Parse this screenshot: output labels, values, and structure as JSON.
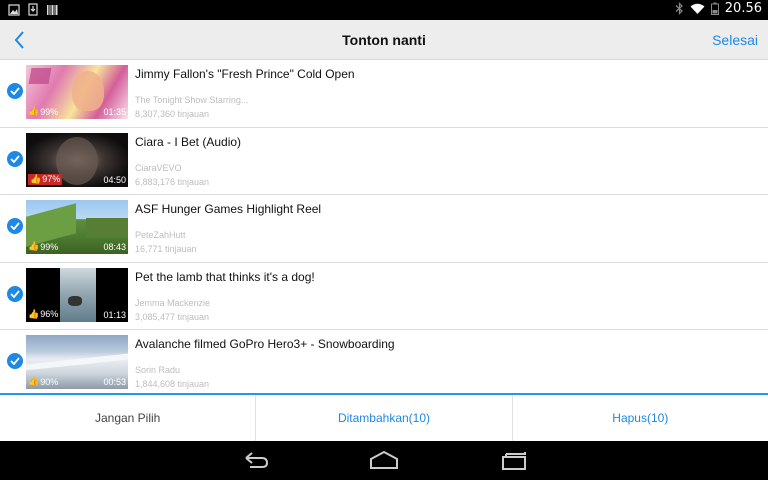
{
  "status_bar": {
    "time": "20.56",
    "icons": [
      "image-icon",
      "download-icon",
      "barcode-icon",
      "bluetooth-icon",
      "wifi-icon",
      "battery-icon"
    ]
  },
  "header": {
    "title": "Tonton nanti",
    "done_label": "Selesai",
    "back_icon": "chevron-left-icon"
  },
  "videos": [
    {
      "title": "Jimmy Fallon's \"Fresh Prince\" Cold Open",
      "channel": "The Tonight Show Starring...",
      "views": "8,307,360 tinjauan",
      "rating": "99%",
      "duration": "01:35",
      "checked": true
    },
    {
      "title": "Ciara - I Bet (Audio)",
      "channel": "CiaraVEVO",
      "views": "6,883,176 tinjauan",
      "rating": "97%",
      "duration": "04:50",
      "checked": true
    },
    {
      "title": "ASF Hunger Games Highlight Reel",
      "channel": "PeteZahHutt",
      "views": "16,771 tinjauan",
      "rating": "99%",
      "duration": "08:43",
      "checked": true
    },
    {
      "title": "Pet the lamb that thinks it's a dog!",
      "channel": "Jemma Mackenzie",
      "views": "3,085,477 tinjauan",
      "rating": "96%",
      "duration": "01:13",
      "checked": true
    },
    {
      "title": "Avalanche filmed GoPro Hero3+ - Snowboarding",
      "channel": "Sorin Radu",
      "views": "1,844,608 tinjauan",
      "rating": "90%",
      "duration": "00:53",
      "checked": true
    }
  ],
  "actions": {
    "deselect": "Jangan Pilih",
    "added": "Ditambahkan(10)",
    "delete": "Hapus(10)"
  },
  "colors": {
    "accent": "#1e88e5",
    "topbar": "#ededed",
    "secondary_text": "#bdbdbd"
  }
}
